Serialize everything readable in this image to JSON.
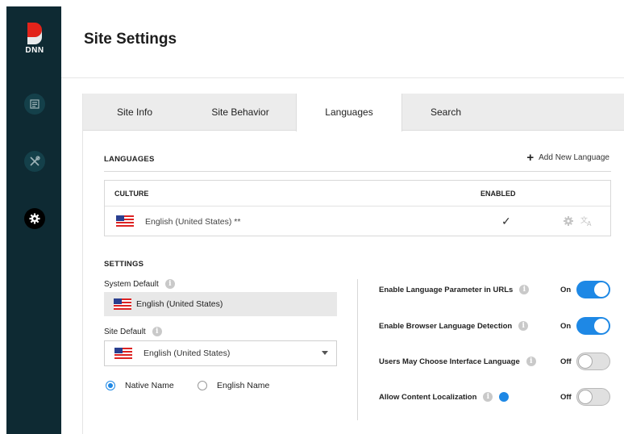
{
  "brand": {
    "logo_text": "DNN",
    "accent": "#e2231a"
  },
  "nav": [
    "content-icon",
    "tools-icon",
    "settings-icon"
  ],
  "page": {
    "title": "Site Settings"
  },
  "tabs": [
    {
      "label": "Site Info",
      "active": false
    },
    {
      "label": "Site Behavior",
      "active": false
    },
    {
      "label": "Languages",
      "active": true
    },
    {
      "label": "Search",
      "active": false
    }
  ],
  "languages": {
    "section_title": "LANGUAGES",
    "add_label": "Add New Language",
    "columns": {
      "culture": "CULTURE",
      "enabled": "ENABLED"
    },
    "rows": [
      {
        "name": "English (United States) **",
        "enabled": true
      }
    ]
  },
  "settings": {
    "section_title": "SETTINGS",
    "system_default_label": "System Default",
    "system_default_value": "English (United States)",
    "site_default_label": "Site Default",
    "site_default_value": "English (United States)",
    "name_options": [
      {
        "label": "Native Name",
        "selected": true
      },
      {
        "label": "English Name",
        "selected": false
      }
    ],
    "options": [
      {
        "label": "Enable Language Parameter in URLs",
        "state": "On"
      },
      {
        "label": "Enable Browser Language Detection",
        "state": "On"
      },
      {
        "label": "Users May Choose Interface Language",
        "state": "Off"
      },
      {
        "label": "Allow Content Localization",
        "state": "Off"
      }
    ]
  },
  "colors": {
    "toggle_on": "#1e88e5",
    "sidebar": "#0e2a33"
  }
}
